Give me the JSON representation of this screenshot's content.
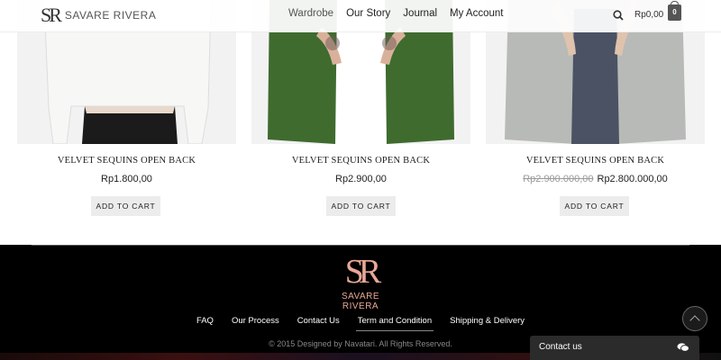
{
  "header": {
    "brand": "SAVARE RIVERA",
    "brand_mark": "SR",
    "nav": [
      "Wardrobe",
      "Our Story",
      "Journal",
      "My Account"
    ],
    "cart_total": "Rp0,00",
    "cart_count": "0"
  },
  "products": [
    {
      "name": "VELVET SEQUINS OPEN BACK",
      "price": "Rp1.800,00",
      "old_price": "",
      "button": "ADD TO CART"
    },
    {
      "name": "VELVET SEQUINS OPEN BACK",
      "price": "Rp2.900,00",
      "old_price": "",
      "button": "ADD TO CART"
    },
    {
      "name": "VELVET SEQUINS OPEN BACK",
      "price": "Rp2.800.000,00",
      "old_price": "Rp2.900.000,00",
      "button": "ADD TO CART"
    }
  ],
  "footer": {
    "brand_mark": "SR",
    "brand": "SAVARE RIVERA",
    "links": [
      "FAQ",
      "Our Process",
      "Contact Us",
      "Term and Condition",
      "Shipping & Delivery"
    ],
    "copyright": "© 2015 Designed by Navatari. All Rights Reserved."
  },
  "contact_widget": {
    "label": "Contact us"
  },
  "icons": {
    "search": "search-icon",
    "bag": "shopping-bag-icon",
    "back_to_top": "chevron-up-icon",
    "chat": "chat-bubbles-icon"
  },
  "colors": {
    "footer_bg": "#000000",
    "brand_accent": "#e9a796",
    "button_bg": "#ececec"
  }
}
